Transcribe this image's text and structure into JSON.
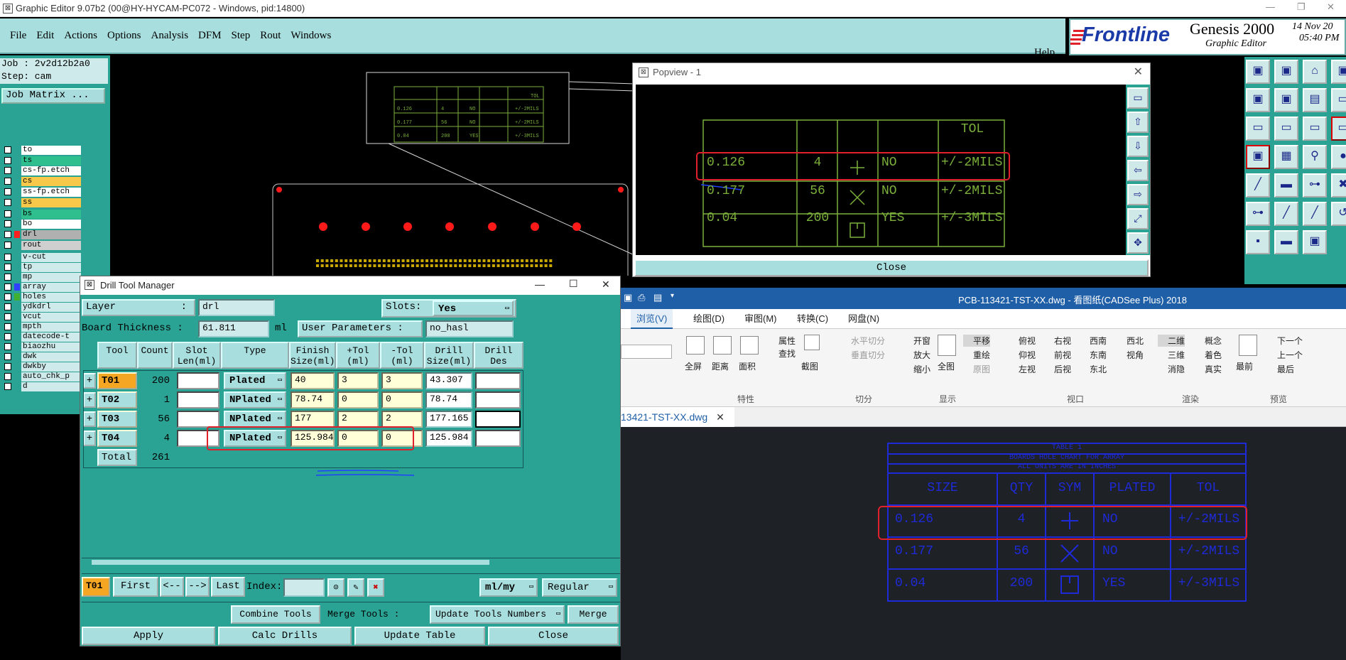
{
  "window": {
    "title": "Graphic Editor 9.07b2 (00@HY-HYCAM-PC072 - Windows, pid:14800)"
  },
  "menu": {
    "items": [
      "File",
      "Edit",
      "Actions",
      "Options",
      "Analysis",
      "DFM",
      "Step",
      "Rout",
      "Windows"
    ],
    "help": "Help"
  },
  "brand": {
    "logo": "Frontline",
    "product": "Genesis 2000",
    "subtitle": "Graphic Editor",
    "date": "14 Nov 20",
    "time": "05:40 PM"
  },
  "job": {
    "job": "Job : 2v2d12b2a0",
    "step": "Step: cam",
    "matrix_button": "Job Matrix ..."
  },
  "layers": [
    {
      "name": "to",
      "color": "#ffffff"
    },
    {
      "name": "ts",
      "color": "#2fbf8f"
    },
    {
      "name": "cs-fp.etch",
      "color": "#ffffff"
    },
    {
      "name": "cs",
      "color": "#f8c84a"
    },
    {
      "name": "ss-fp.etch",
      "color": "#ffffff"
    },
    {
      "name": "ss",
      "color": "#f8c84a"
    },
    {
      "name": "bs",
      "color": "#2fbf8f"
    },
    {
      "name": "bo",
      "color": "#ffffff"
    },
    {
      "name": "drl",
      "color": "#b0b0b0",
      "swatch": "#ff2020"
    },
    {
      "name": "rout",
      "color": "#cfcfcf"
    },
    {
      "name": "v-cut",
      "color": "#cfeaea"
    },
    {
      "name": "tp",
      "color": "#cfeaea"
    },
    {
      "name": "mp",
      "color": "#cfeaea"
    },
    {
      "name": "array",
      "color": "#cfeaea",
      "swatch": "#3040ff"
    },
    {
      "name": "holes",
      "color": "#cfeaea",
      "swatch": "#40b030"
    },
    {
      "name": "ydkdrl",
      "color": "#cfeaea"
    },
    {
      "name": "vcut",
      "color": "#cfeaea"
    },
    {
      "name": "mpth",
      "color": "#cfeaea"
    },
    {
      "name": "datecode-t",
      "color": "#cfeaea"
    },
    {
      "name": "biaozhu",
      "color": "#cfeaea"
    },
    {
      "name": "dwk",
      "color": "#cfeaea"
    },
    {
      "name": "dwkby",
      "color": "#cfeaea"
    },
    {
      "name": "auto_chk_p",
      "color": "#cfeaea"
    },
    {
      "name": "d",
      "color": "#cfeaea"
    }
  ],
  "canvas_table": {
    "header_tol": "TOL",
    "rows": [
      [
        "0.126",
        "4",
        "NO",
        "+/-2MILS"
      ],
      [
        "0.177",
        "56",
        "NO",
        "+/-2MILS"
      ],
      [
        "0.04",
        "200",
        "YES",
        "+/-3MILS"
      ]
    ]
  },
  "popview": {
    "title": "Popview - 1",
    "close": "Close",
    "headers": [
      "",
      "",
      "",
      "",
      "TOL"
    ],
    "rows": [
      [
        "0.126",
        "4",
        "NO",
        "+/-2MILS"
      ],
      [
        "0.177",
        "56",
        "NO",
        "+/-2MILS"
      ],
      [
        "0.04",
        "200",
        "YES",
        "+/-3MILS"
      ]
    ]
  },
  "cadsee": {
    "title": "PCB-113421-TST-XX.dwg - 看图纸(CADSee Plus) 2018",
    "tabs": [
      "浏览(V)",
      "绘图(D)",
      "审图(M)",
      "转换(C)",
      "网盘(N)"
    ],
    "ribbon": {
      "props": [
        "全屏",
        "距离",
        "面积",
        "属性",
        "查找",
        "截图"
      ],
      "props_group": "特性",
      "cut": [
        "水平切分",
        "垂直切分"
      ],
      "cut_group": "切分",
      "display": [
        "开窗",
        "放大",
        "缩小",
        "全图",
        "平移",
        "重绘",
        "原图"
      ],
      "display_group": "显示",
      "view": [
        "俯视",
        "仰视",
        "左视",
        "右视",
        "前视",
        "后视",
        "西南",
        "东南",
        "东北",
        "西北",
        "视角"
      ],
      "view_group": "视口",
      "render": [
        "二维",
        "三维",
        "消隐",
        "概念",
        "着色",
        "真实"
      ],
      "render_group": "渲染",
      "preview": [
        "最前",
        "下一个",
        "上一个",
        "最后"
      ],
      "preview_group": "预览"
    },
    "doc_tab": "13421-TST-XX.dwg",
    "drawing": {
      "title1": "TABLE 1",
      "title2": "BOARDS HOLE CHART FOR ARRAY",
      "title3": "ALL UNITS ARE IN INCHES",
      "headers": [
        "SIZE",
        "QTY",
        "SYM",
        "PLATED",
        "TOL"
      ],
      "rows": [
        [
          "0.126",
          "4",
          "NO",
          "+/-2MILS"
        ],
        [
          "0.177",
          "56",
          "NO",
          "+/-2MILS"
        ],
        [
          "0.04",
          "200",
          "YES",
          "+/-3MILS"
        ]
      ]
    }
  },
  "dtm": {
    "title": "Drill Tool Manager",
    "layer_label": "Layer",
    "layer_sep": ":",
    "layer_value": "drl",
    "slots_label": "Slots:",
    "slots_value": "Yes",
    "thickness_label": "Board Thickness :",
    "thickness_value": "61.811",
    "thickness_unit": "ml",
    "user_params_label": "User Parameters :",
    "user_params_value": "no_hasl",
    "headers": [
      "Tool",
      "Count",
      "Slot Len(ml)",
      "Type",
      "Finish Size(ml)",
      "+Tol (ml)",
      "-Tol (ml)",
      "Drill Size(ml)",
      "Drill Des"
    ],
    "rows": [
      {
        "tool": "T01",
        "count": "200",
        "type": "Plated",
        "finish": "40",
        "ptol": "3",
        "mtol": "3",
        "drill": "43.307"
      },
      {
        "tool": "T02",
        "count": "1",
        "type": "NPlated",
        "finish": "78.74",
        "ptol": "0",
        "mtol": "0",
        "drill": "78.74"
      },
      {
        "tool": "T03",
        "count": "56",
        "type": "NPlated",
        "finish": "177",
        "ptol": "2",
        "mtol": "2",
        "drill": "177.165"
      },
      {
        "tool": "T04",
        "count": "4",
        "type": "NPlated",
        "finish": "125.984",
        "ptol": "0",
        "mtol": "0",
        "drill": "125.984"
      }
    ],
    "total_label": "Total",
    "total_value": "261",
    "nav": {
      "current": "T01",
      "first": "First",
      "prev": "<--",
      "next": "-->",
      "last": "Last",
      "index": "Index:",
      "units": "ml/my",
      "mode": "Regular"
    },
    "actions": {
      "combine": "Combine Tools",
      "merge_label": "Merge Tools :",
      "update_numbers": "Update Tools Numbers",
      "merge": "Merge",
      "apply": "Apply",
      "calc": "Calc Drills",
      "update_table": "Update Table",
      "close": "Close"
    }
  },
  "colors": {
    "teal": "#2aa394",
    "light_teal": "#a8dede",
    "highlight_red": "#e0202a",
    "pad_red": "#ff1a1a",
    "pcb_green": "#7bb03a",
    "cad_blue": "#1e2ad8"
  }
}
